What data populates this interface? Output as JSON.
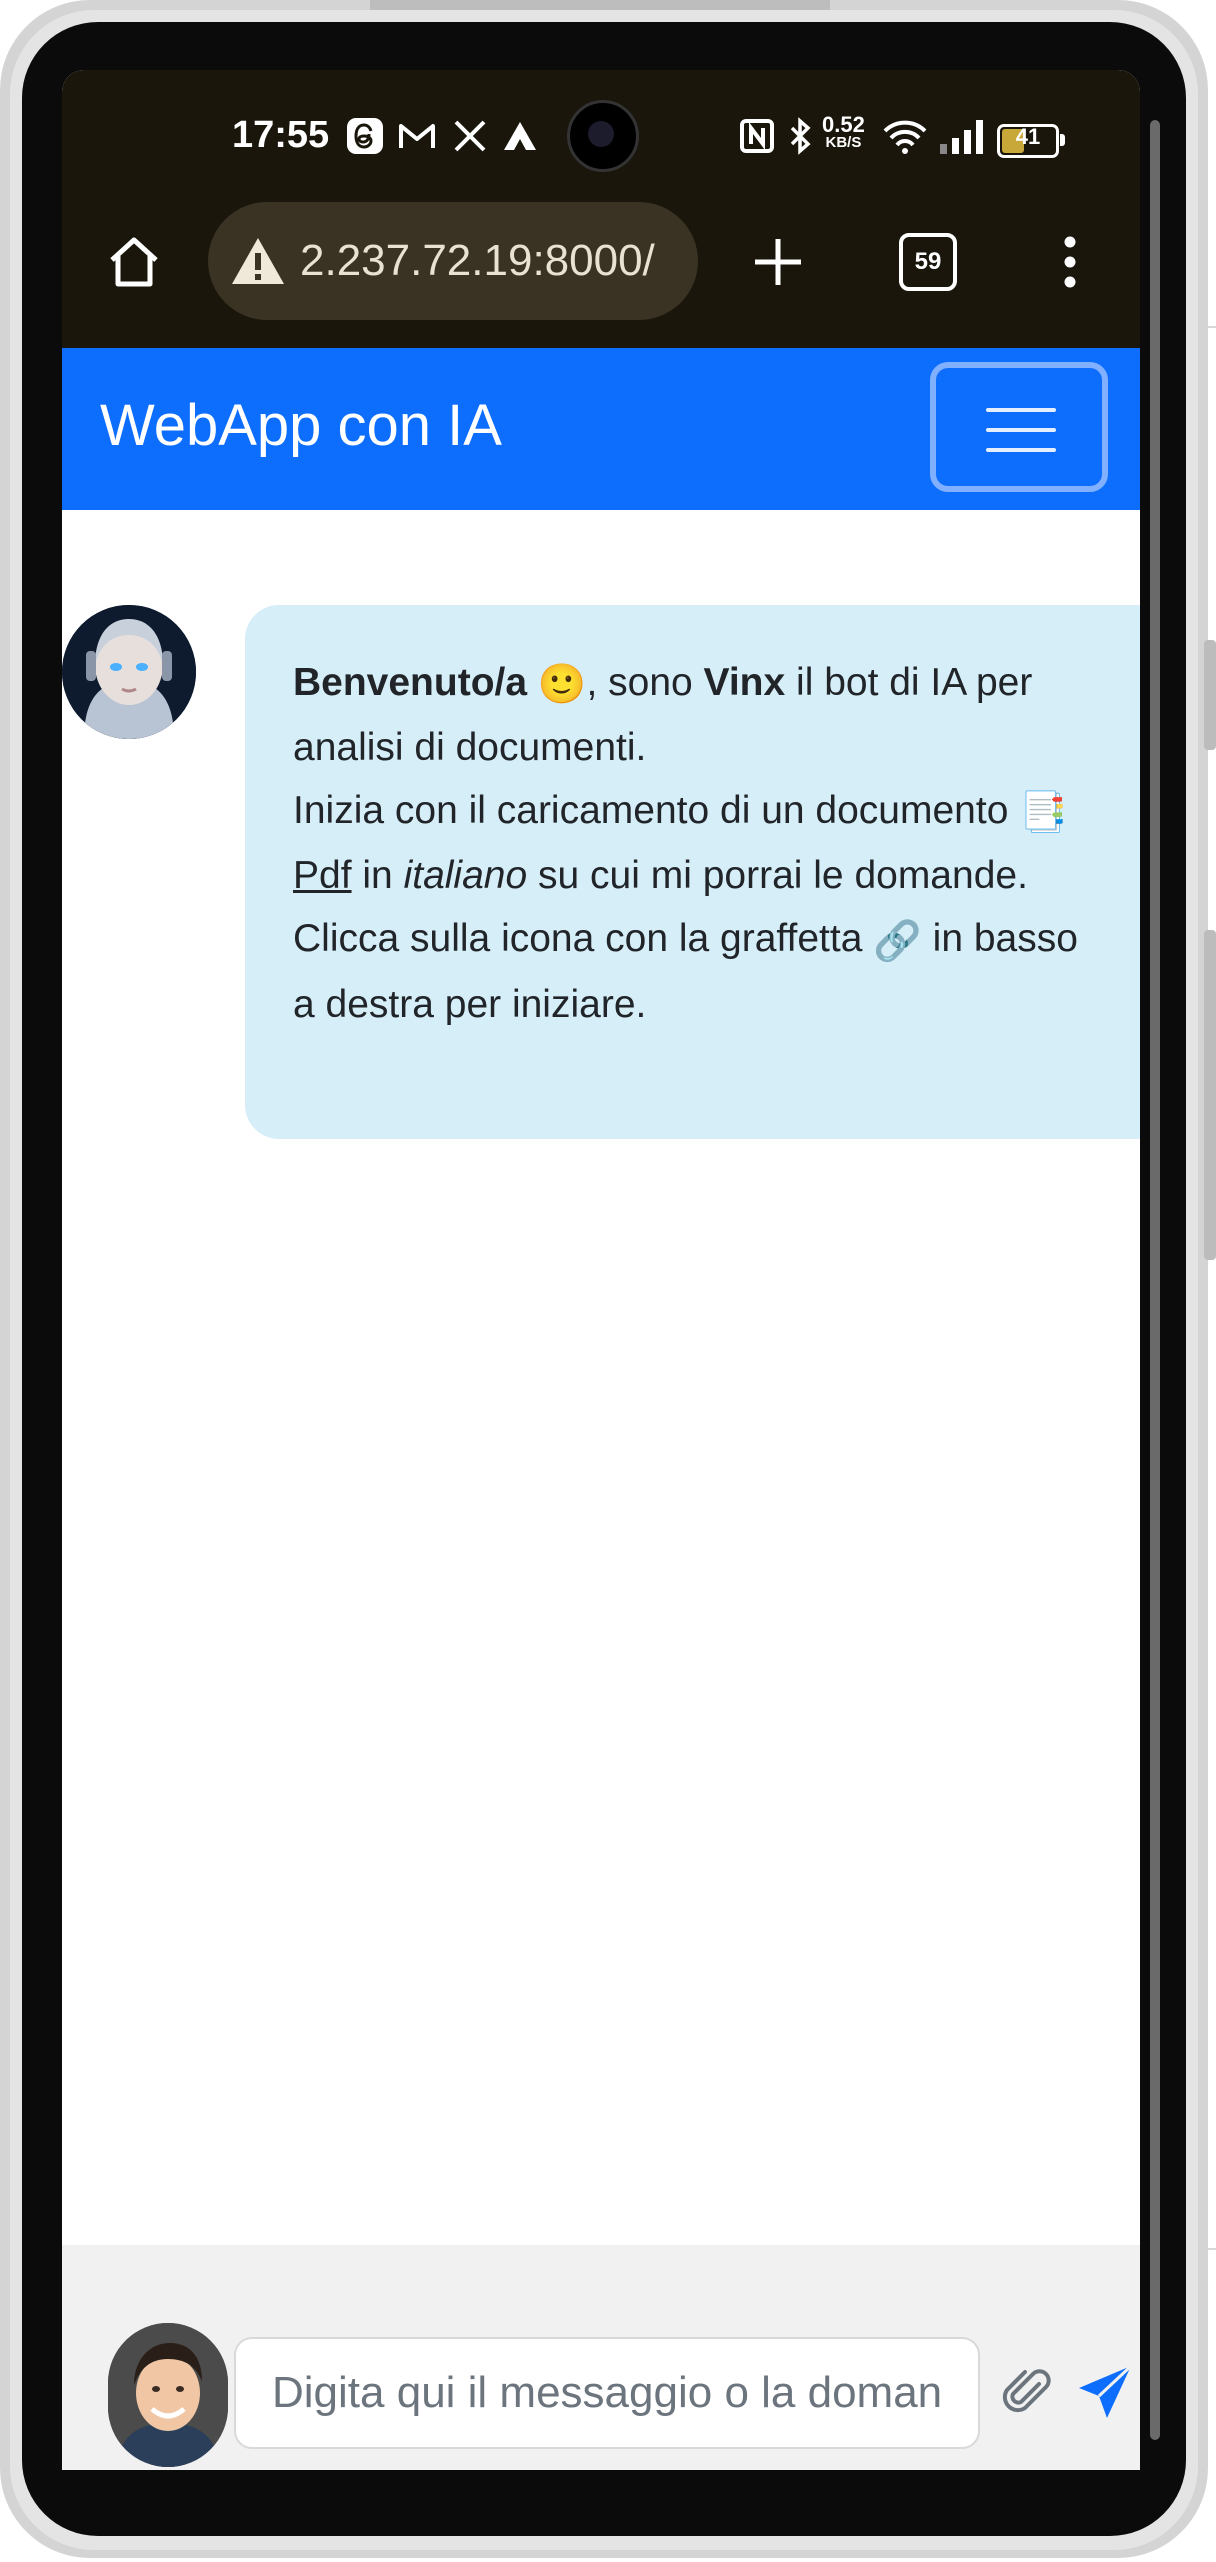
{
  "status_bar": {
    "time": "17:55",
    "net_speed_value": "0.52",
    "net_speed_unit": "KB/S",
    "battery_level": "41",
    "icons": [
      "threads-icon",
      "gmail-icon",
      "x-icon",
      "app-icon",
      "nfc-icon",
      "bluetooth-icon",
      "wifi-icon",
      "signal-icon",
      "battery-icon"
    ]
  },
  "browser": {
    "url": "2.237.72.19:8000/",
    "tab_count": "59",
    "icons": [
      "home-icon",
      "warning-icon",
      "new-tab-icon",
      "tabs-icon",
      "more-icon"
    ]
  },
  "navbar": {
    "brand": "WebApp con IA",
    "color": "#0d6efd"
  },
  "chat": {
    "bot_message": {
      "greet_bold": "Benvenuto/a",
      "emoji_smile": "🙂",
      "greet_rest": ", sono ",
      "bot_name": "Vinx",
      "greet_tail": " il bot di IA per analisi di documenti.",
      "line2_start": "Inizia con il caricamento di un documento ",
      "emoji_doc": "📑",
      "pdf_word": "Pdf",
      "line2_mid": " in ",
      "italiano": "italiano",
      "line2_end": " su cui mi porrai le domande.",
      "line3_start": "Clicca sulla icona con la graffetta ",
      "emoji_link": "🔗",
      "line3_end": " in basso a destra per iniziare."
    },
    "bubble_color": "#d6eef8"
  },
  "input": {
    "placeholder": "Digita qui il messaggio o la domanda",
    "value": ""
  }
}
